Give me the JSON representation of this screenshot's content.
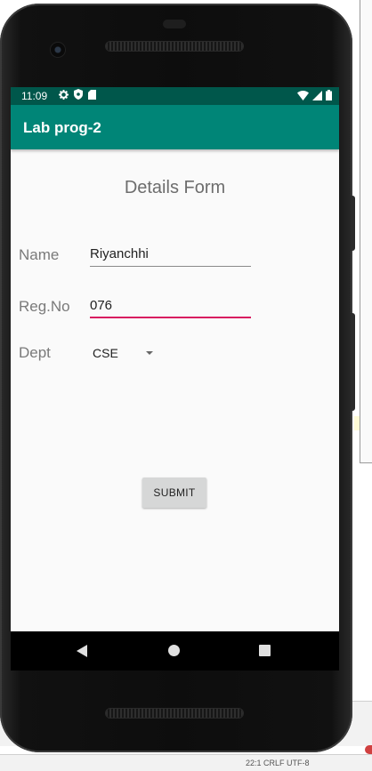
{
  "status_bar": {
    "time": "11:09"
  },
  "app_bar": {
    "title": "Lab prog-2"
  },
  "form": {
    "title": "Details Form",
    "name_label": "Name",
    "name_value": "Riyanchhi",
    "regno_label": "Reg.No",
    "regno_value": "076",
    "dept_label": "Dept",
    "dept_selected": "CSE"
  },
  "submit_label": "SUBMIT",
  "colors": {
    "primary": "#008577",
    "primary_dark": "#00574b",
    "accent": "#d81b60",
    "background": "#fafafa"
  },
  "icons": {
    "status_left": [
      "gear-icon",
      "shield-icon",
      "sd-card-icon"
    ],
    "status_right": [
      "wifi-icon",
      "signal-icon",
      "battery-icon"
    ],
    "navigation": [
      "back-icon",
      "home-icon",
      "recents-icon"
    ]
  },
  "ide_status": {
    "text": "22:1   CRLF   UTF-8"
  }
}
